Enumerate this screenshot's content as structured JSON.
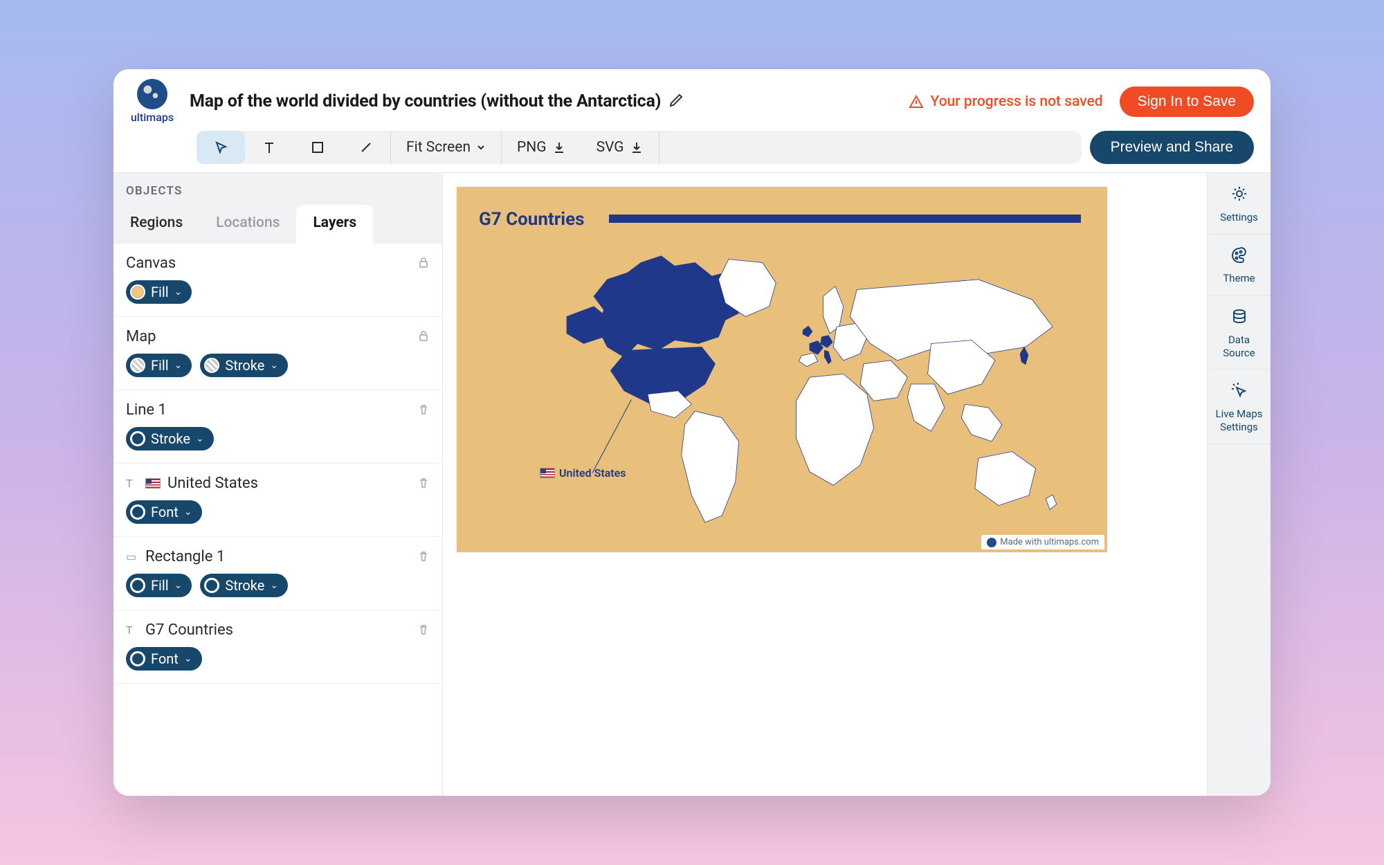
{
  "brand": {
    "name": "ultimaps"
  },
  "header": {
    "title": "Map of the world divided by countries (without the Antarctica)",
    "warning": "Your progress is not saved",
    "signin": "Sign In to Save",
    "preview": "Preview and Share"
  },
  "toolbar": {
    "zoom": "Fit Screen",
    "export_png": "PNG",
    "export_svg": "SVG"
  },
  "sidebar": {
    "objects_label": "OBJECTS",
    "tabs": [
      {
        "label": "Regions",
        "active": false,
        "dark": true
      },
      {
        "label": "Locations",
        "active": false,
        "dark": false
      },
      {
        "label": "Layers",
        "active": true,
        "dark": true
      }
    ],
    "layers": [
      {
        "name": "Canvas",
        "lock": true,
        "pre": "",
        "chips": [
          {
            "label": "Fill",
            "swatch": "tan"
          }
        ]
      },
      {
        "name": "Map",
        "lock": true,
        "pre": "",
        "chips": [
          {
            "label": "Fill",
            "swatch": "tex"
          },
          {
            "label": "Stroke",
            "swatch": "tex"
          }
        ]
      },
      {
        "name": "Line 1",
        "delete": true,
        "pre": "",
        "chips": [
          {
            "label": "Stroke",
            "swatch": "ring"
          }
        ]
      },
      {
        "name": "United States",
        "delete": true,
        "pre": "T",
        "flag": true,
        "chips": [
          {
            "label": "Font",
            "swatch": "ring"
          }
        ]
      },
      {
        "name": "Rectangle 1",
        "delete": true,
        "pre": "rect",
        "chips": [
          {
            "label": "Fill",
            "swatch": "ring"
          },
          {
            "label": "Stroke",
            "swatch": "ring"
          }
        ]
      },
      {
        "name": "G7 Countries",
        "delete": true,
        "pre": "T",
        "chips": [
          {
            "label": "Font",
            "swatch": "ring"
          }
        ]
      }
    ]
  },
  "canvas": {
    "map_title": "G7 Countries",
    "label_us": "United States",
    "watermark": "Made with ultimaps.com"
  },
  "rail": {
    "items": [
      {
        "label": "Settings",
        "icon": "gear"
      },
      {
        "label": "Theme",
        "icon": "palette"
      },
      {
        "label": "Data Source",
        "icon": "database"
      },
      {
        "label": "Live Maps Settings",
        "icon": "cursor"
      }
    ]
  }
}
